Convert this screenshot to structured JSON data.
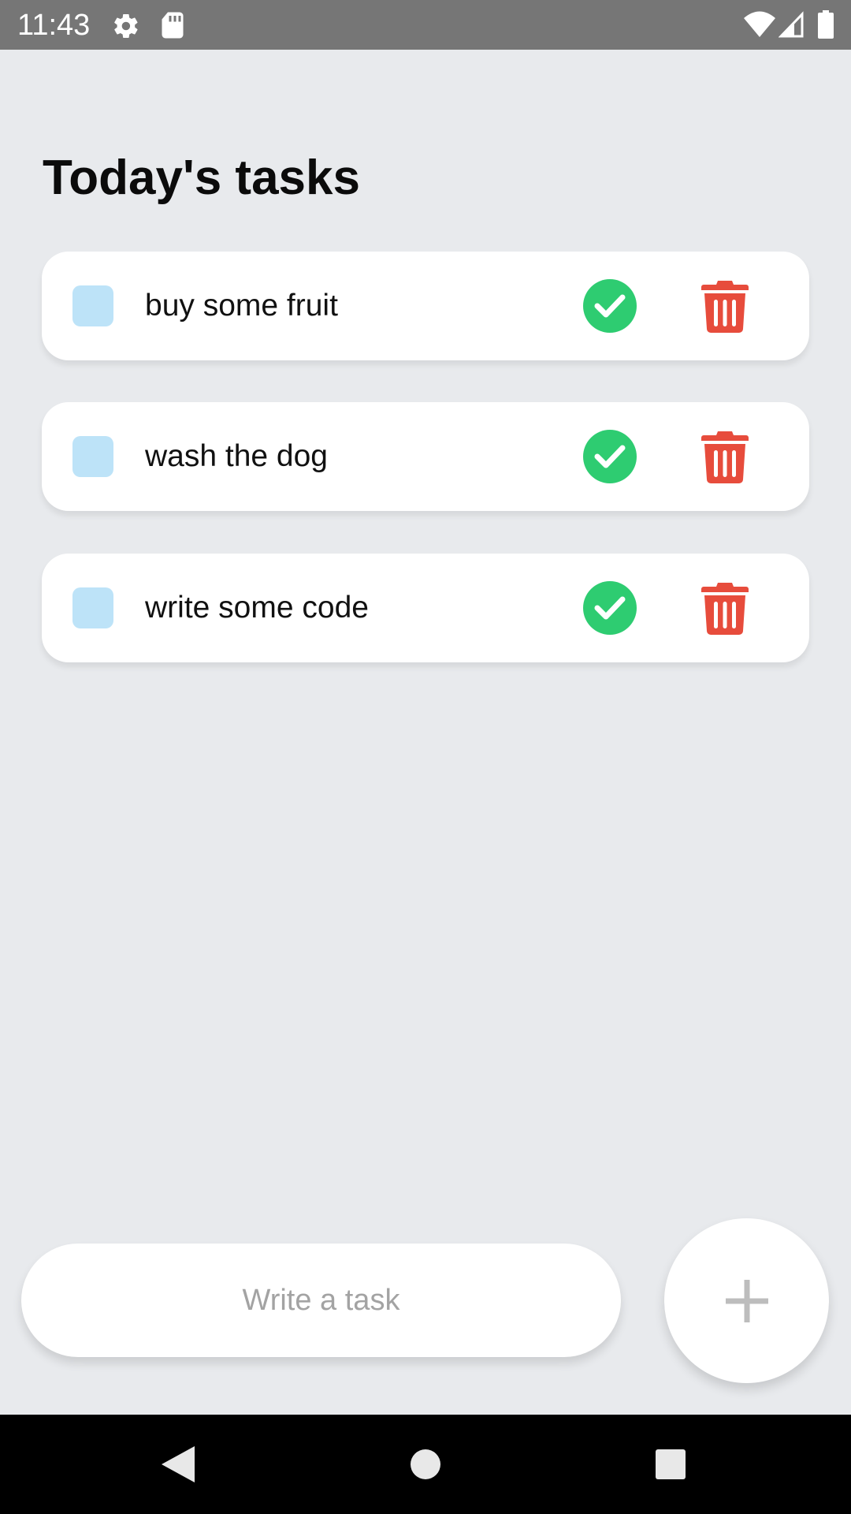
{
  "status_bar": {
    "time": "11:43",
    "left_icons": [
      "gear-icon",
      "sd-card-icon"
    ],
    "right_icons": [
      "wifi-icon",
      "cell-signal-icon",
      "battery-icon"
    ]
  },
  "page": {
    "title": "Today's tasks"
  },
  "tasks": [
    {
      "text": "buy some fruit",
      "checked": false
    },
    {
      "text": "wash the dog",
      "checked": false
    },
    {
      "text": "write some code",
      "checked": false
    }
  ],
  "composer": {
    "placeholder": "Write a task",
    "value": "",
    "add_icon": "plus-icon"
  },
  "nav_bar": {
    "buttons": [
      "back-icon",
      "home-icon",
      "recents-icon"
    ]
  },
  "colors": {
    "background": "#e8eaed",
    "status_bar": "#767676",
    "checkbox": "#bde3f8",
    "complete": "#2ecc71",
    "delete": "#e74c3c",
    "card": "#ffffff"
  }
}
